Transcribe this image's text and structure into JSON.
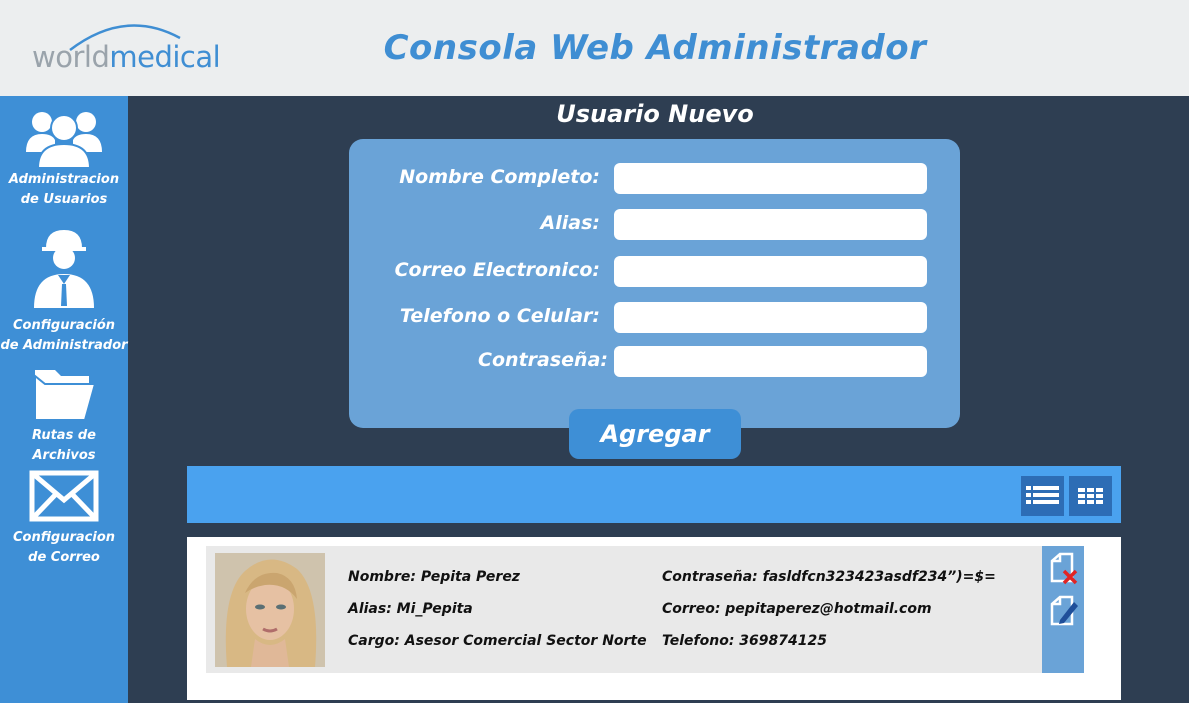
{
  "header": {
    "logo_world": "world",
    "logo_medical": "medical",
    "title": "Consola Web Administrador"
  },
  "sidebar": {
    "items": [
      {
        "icon": "users-icon",
        "line1": "Administracion",
        "line2": "de Usuarios"
      },
      {
        "icon": "admin-icon",
        "line1": "Configuración",
        "line2": "de Administrador"
      },
      {
        "icon": "folder-icon",
        "line1": "Rutas de",
        "line2": "Archivos"
      },
      {
        "icon": "mail-icon",
        "line1": "Configuracion",
        "line2": "de Correo"
      }
    ]
  },
  "form": {
    "title": "Usuario Nuevo",
    "fields": [
      {
        "label": "Nombre Completo:",
        "value": ""
      },
      {
        "label": "Alias:",
        "value": ""
      },
      {
        "label": "Correo Electronico:",
        "value": ""
      },
      {
        "label": "Telefono o Celular:",
        "value": ""
      },
      {
        "label": "Contraseña:",
        "value": ""
      }
    ],
    "submit_label": "Agregar"
  },
  "toolbar": {
    "views": [
      {
        "icon": "list-view-icon"
      },
      {
        "icon": "grid-view-icon"
      }
    ]
  },
  "users": [
    {
      "nombre": "Nombre: Pepita Perez",
      "alias": "Alias: Mi_Pepita",
      "cargo": "Cargo: Asesor Comercial Sector Norte",
      "contrasena": "Contraseña: fasldfcn323423asdf234”)=$=",
      "correo": "Correo: pepitaperez@hotmail.com",
      "telefono": "Telefono: 369874125"
    }
  ],
  "colors": {
    "header_bg": "#eceeef",
    "accent": "#3e8fd6",
    "panel": "#6aa3d7",
    "background": "#2e3e52",
    "delete": "#e02424"
  }
}
